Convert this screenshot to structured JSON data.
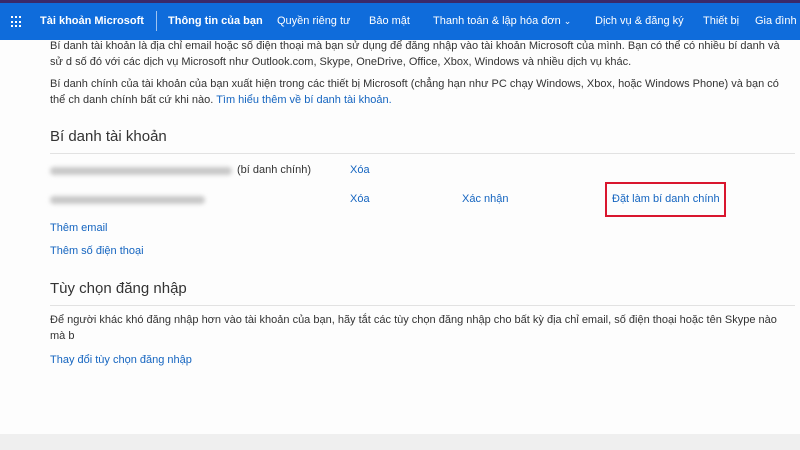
{
  "nav": {
    "brand": "Tài khoản Microsoft",
    "items": [
      "Thông tin của bạn",
      "Quyền riêng tư",
      "Bảo mật",
      "Thanh toán & lập hóa đơn",
      "Dịch vụ & đăng ký",
      "Thiết bị",
      "Gia đình"
    ]
  },
  "intro": {
    "p1_line1": "Bí danh tài khoản là địa chỉ email hoặc số điện thoại mà bạn sử dụng để đăng nhập vào tài khoản Microsoft của mình. Bạn có thể có nhiều bí danh và sử d",
    "p1_line2": "số đó với các dịch vụ Microsoft như Outlook.com, Skype, OneDrive, Office, Xbox, Windows và nhiều dịch vụ khác.",
    "p2_line1": "Bí danh chính của tài khoản của bạn xuất hiện trong các thiết bị Microsoft (chẳng hạn như PC chạy Windows, Xbox, hoặc Windows Phone) và bạn có thể ch",
    "p2_line2": "danh chính bất cứ khi nào.",
    "learn_more": "Tìm hiểu thêm về bí danh tài khoản."
  },
  "aliases": {
    "title": "Bí danh tài khoản",
    "primary_suffix": "(bí danh chính)",
    "remove": "Xóa",
    "verify": "Xác nhận",
    "make_primary": "Đặt làm bí danh chính",
    "add_email": "Thêm email",
    "add_phone": "Thêm số điện thoại"
  },
  "signin": {
    "title": "Tùy chọn đăng nhập",
    "desc": "Để người khác khó đăng nhập hơn vào tài khoản của bạn, hãy tắt các tùy chọn đăng nhập cho bất kỳ địa chỉ email, số điện thoại hoặc tên Skype nào mà b",
    "change": "Thay đổi tùy chọn đăng nhập"
  }
}
